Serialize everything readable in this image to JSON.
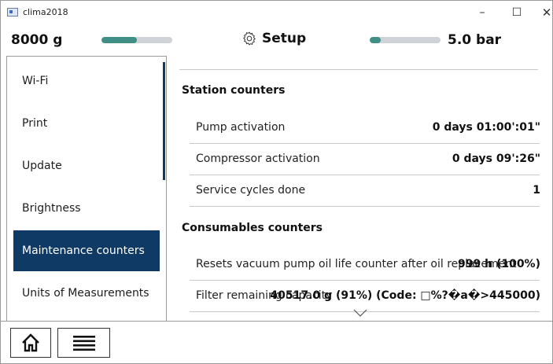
{
  "window": {
    "title": "clima2018",
    "minimize": "–",
    "maximize": "☐",
    "close": "✕"
  },
  "header": {
    "weight": "8000 g",
    "weight_level": 0.5,
    "setup_label": "Setup",
    "pressure": "5.0 bar",
    "pressure_level": 0.15,
    "accent": "#3f8f86"
  },
  "sidebar": {
    "items": [
      {
        "label": "Wi-Fi",
        "active": false
      },
      {
        "label": "Print",
        "active": false
      },
      {
        "label": "Update",
        "active": false
      },
      {
        "label": "Brightness",
        "active": false
      },
      {
        "label": "Maintenance counters",
        "active": true
      },
      {
        "label": "Units of Measurements",
        "active": false
      }
    ],
    "active_color": "#0f3a66"
  },
  "main": {
    "station_title": "Station counters",
    "station_rows": [
      {
        "label": "Pump activation",
        "value": "0 days  01:00':01\""
      },
      {
        "label": "Compressor activation",
        "value": "0 days  09':26\""
      },
      {
        "label": "Service cycles done",
        "value": "1"
      }
    ],
    "consumables_title": "Consumables counters",
    "consumables_rows": [
      {
        "label": "Resets vacuum pump oil life counter after oil replacement",
        "value": "999 h (100%)"
      },
      {
        "label": "Filter remaining capacity",
        "value": "40517.0 g (91%) (Code: □%?�a�>445000)"
      }
    ]
  },
  "toolbar": {
    "home_icon": "home-icon",
    "menu_icon": "hamburger-menu-icon"
  }
}
